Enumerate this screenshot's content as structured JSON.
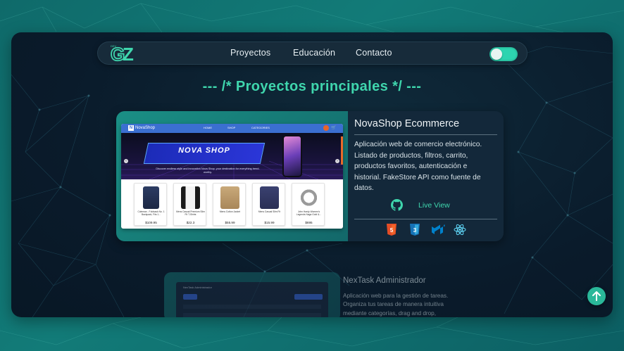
{
  "navbar": {
    "logo_text": "GZ",
    "links": [
      "Proyectos",
      "Educación",
      "Contacto"
    ],
    "theme_toggle": "on"
  },
  "section": {
    "title": "--- /* Proyectos principales */ ---"
  },
  "projects": [
    {
      "title": "NovaShop Ecommerce",
      "description": "Aplicación web de comercio electrónico. Listado de productos, filtros, carrito, productos favoritos, autenticación e historial. FakeStore API como fuente de datos.",
      "github_icon": "github-icon",
      "live_label": "Live View",
      "tech_icons": [
        "html5-icon",
        "css3-icon",
        "mui-icon",
        "react-icon"
      ],
      "preview": {
        "brand": "NovaShop",
        "menu": [
          "HOME",
          "SHOP",
          "CATEGORIES"
        ],
        "hero_text": "NOVA SHOP",
        "hero_sub": "Discover endless style and innovation\nNova Shop, your destination for everything trend-worthy.",
        "products": [
          {
            "name": "Coleman - Foldsack No. 1 Backpack, Fits 1...",
            "price": "$109.95"
          },
          {
            "name": "Mens Casual Premium Slim Fit T-Shirts",
            "price": "$22.3"
          },
          {
            "name": "Mens Cotton Jacket",
            "price": "$55.99"
          },
          {
            "name": "Mens Casual Slim Fit",
            "price": "$15.99"
          },
          {
            "name": "John Hardy Women's Legends Naga Gold &...",
            "price": "$695"
          }
        ]
      }
    },
    {
      "title": "NexTask Administrador",
      "description": "Aplicación web para la gestión de tareas. Organiza tus tareas de manera intuitiva mediante categorías, drag and drop,",
      "preview": {
        "brand": "NexTask Administrador"
      }
    }
  ],
  "scroll_top": {
    "icon": "arrow-up-icon"
  },
  "colors": {
    "accent": "#3fd6ad",
    "frame_bg": "#0a1b2b",
    "card_bg": "#13283a"
  }
}
